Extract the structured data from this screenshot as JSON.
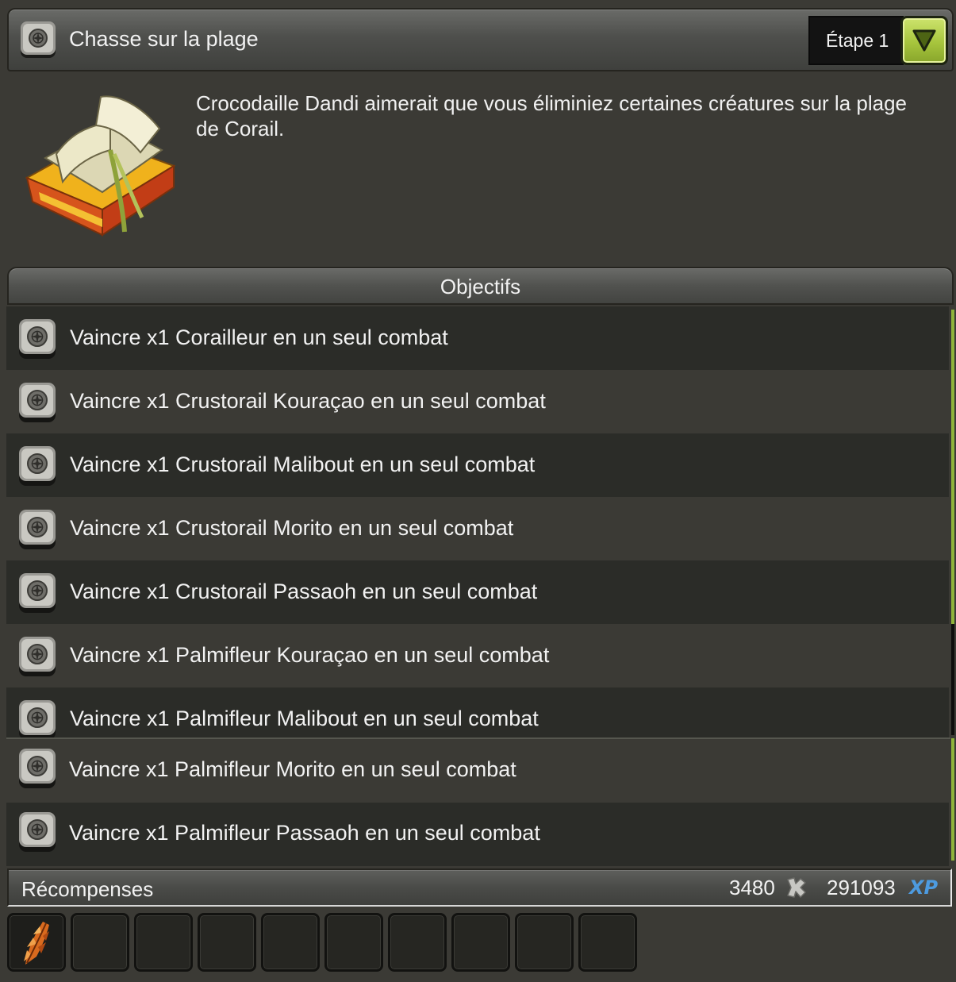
{
  "quest": {
    "title": "Chasse sur la plage",
    "step_label": "Étape 1",
    "description": "Crocodaille Dandi aimerait que vous éliminiez certaines créatures sur la plage de Corail."
  },
  "objectives": {
    "title": "Objectifs",
    "items": [
      "Vaincre x1 Corailleur en un seul combat",
      "Vaincre x1 Crustorail Kouraçao en un seul combat",
      "Vaincre x1 Crustorail Malibout en un seul combat",
      "Vaincre x1 Crustorail Morito en un seul combat",
      "Vaincre x1 Crustorail Passaoh en un seul combat",
      "Vaincre x1 Palmifleur Kouraçao en un seul combat",
      "Vaincre x1 Palmifleur Malibout en un seul combat",
      "Vaincre x1 Palmifleur Morito en un seul combat",
      "Vaincre x1 Palmifleur Passaoh en un seul combat"
    ]
  },
  "rewards": {
    "title": "Récompenses",
    "kamas": "3480",
    "xp": "291093",
    "xp_label": "XP",
    "slot_count": 10,
    "filled_slots": 1
  },
  "colors": {
    "accent_green": "#a7c53d",
    "xp_blue": "#4d9be0"
  },
  "icons": {
    "quest": "compass-icon",
    "step_toggle": "chevron-down-icon",
    "kamas": "kama-icon",
    "reward_item": "feather-item-icon"
  }
}
